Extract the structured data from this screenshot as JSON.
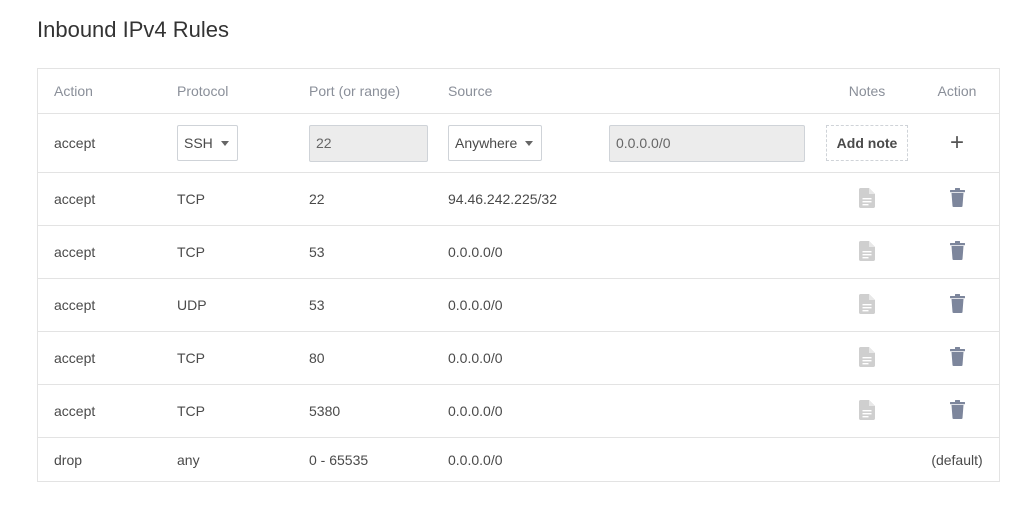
{
  "title": "Inbound IPv4 Rules",
  "headers": {
    "action": "Action",
    "protocol": "Protocol",
    "port": "Port (or range)",
    "source": "Source",
    "notes": "Notes",
    "action2": "Action"
  },
  "new_rule": {
    "action": "accept",
    "protocol": "SSH",
    "port": "22",
    "source": "Anywhere",
    "source_ip": "0.0.0.0/0",
    "add_note": "Add note",
    "add": "+"
  },
  "rules": [
    {
      "action": "accept",
      "protocol": "TCP",
      "port": "22",
      "source": "94.46.242.225/32"
    },
    {
      "action": "accept",
      "protocol": "TCP",
      "port": "53",
      "source": "0.0.0.0/0"
    },
    {
      "action": "accept",
      "protocol": "UDP",
      "port": "53",
      "source": "0.0.0.0/0"
    },
    {
      "action": "accept",
      "protocol": "TCP",
      "port": "80",
      "source": "0.0.0.0/0"
    },
    {
      "action": "accept",
      "protocol": "TCP",
      "port": "5380",
      "source": "0.0.0.0/0"
    }
  ],
  "default_rule": {
    "action": "drop",
    "protocol": "any",
    "port": "0 - 65535",
    "source": "0.0.0.0/0",
    "label": "(default)"
  },
  "icons": {
    "note": "document-icon",
    "delete": "trash-icon"
  },
  "colors": {
    "note_icon": "#cfcfcf",
    "delete_icon": "#7d869c",
    "border": "#e3e3e3",
    "header_text": "#8a8f99"
  }
}
